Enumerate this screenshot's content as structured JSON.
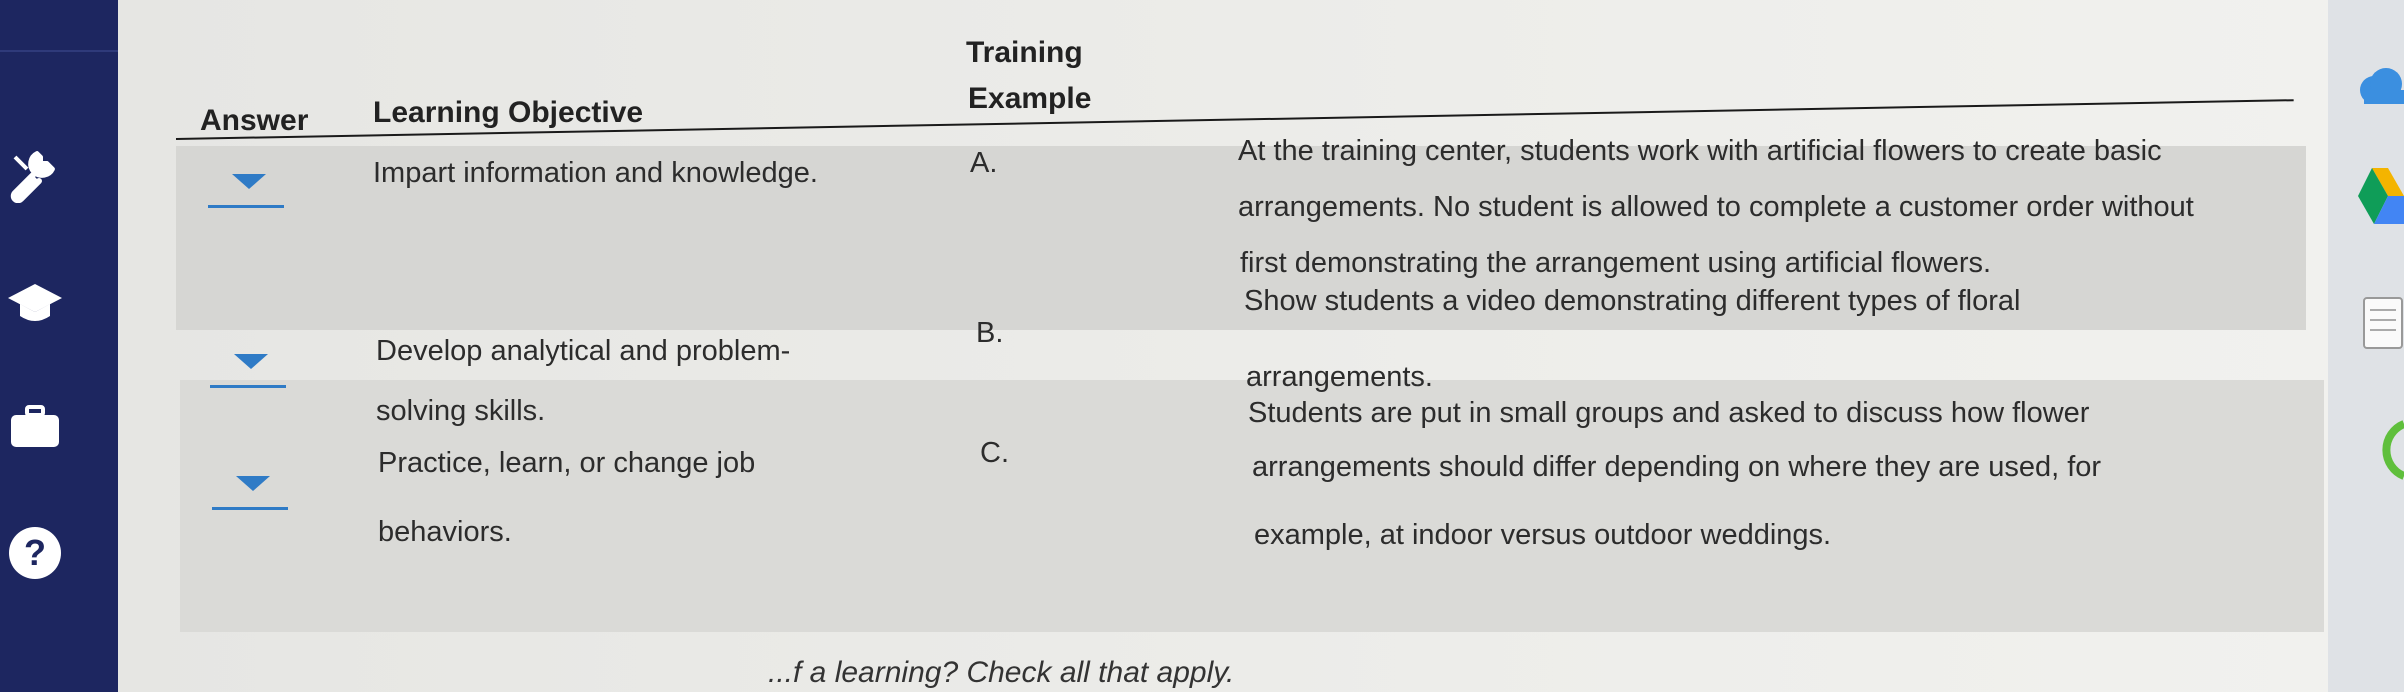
{
  "table": {
    "headers": {
      "answer": "Answer",
      "objective": "Learning Objective",
      "example_line1": "Training",
      "example_line2": "Example"
    },
    "rows": [
      {
        "objective_lines": [
          "Impart information and knowledge."
        ],
        "letter": "A.",
        "example_lines": [
          "At the training center, students work with artificial flowers to create basic",
          "arrangements. No student is allowed to complete a customer order without",
          "first demonstrating the arrangement using artificial flowers."
        ]
      },
      {
        "objective_lines": [
          "Develop analytical and problem-",
          "solving skills."
        ],
        "letter": "B.",
        "example_lines": [
          "Show students a video demonstrating different types of floral",
          "arrangements."
        ]
      },
      {
        "objective_lines": [
          "Practice, learn, or change job",
          "behaviors."
        ],
        "letter": "C.",
        "example_lines": [
          "Students are put in small groups and asked to discuss how flower",
          "arrangements should differ depending on where they are used, for",
          "example, at indoor versus outdoor weddings."
        ]
      }
    ]
  },
  "bottom_partial_text": "...f a learning?  Check all that apply.",
  "sidebar": {
    "icons": [
      "wrench-icon",
      "graduation-cap-icon",
      "briefcase-icon",
      "help-icon"
    ]
  },
  "right_strip": {
    "icons": [
      "cloud-icon",
      "drive-icon",
      "notes-icon",
      "circle-app-icon"
    ]
  },
  "colors": {
    "sidebar": "#1d2660",
    "accent": "#2f7bc6",
    "band": "#d6d6d3"
  }
}
